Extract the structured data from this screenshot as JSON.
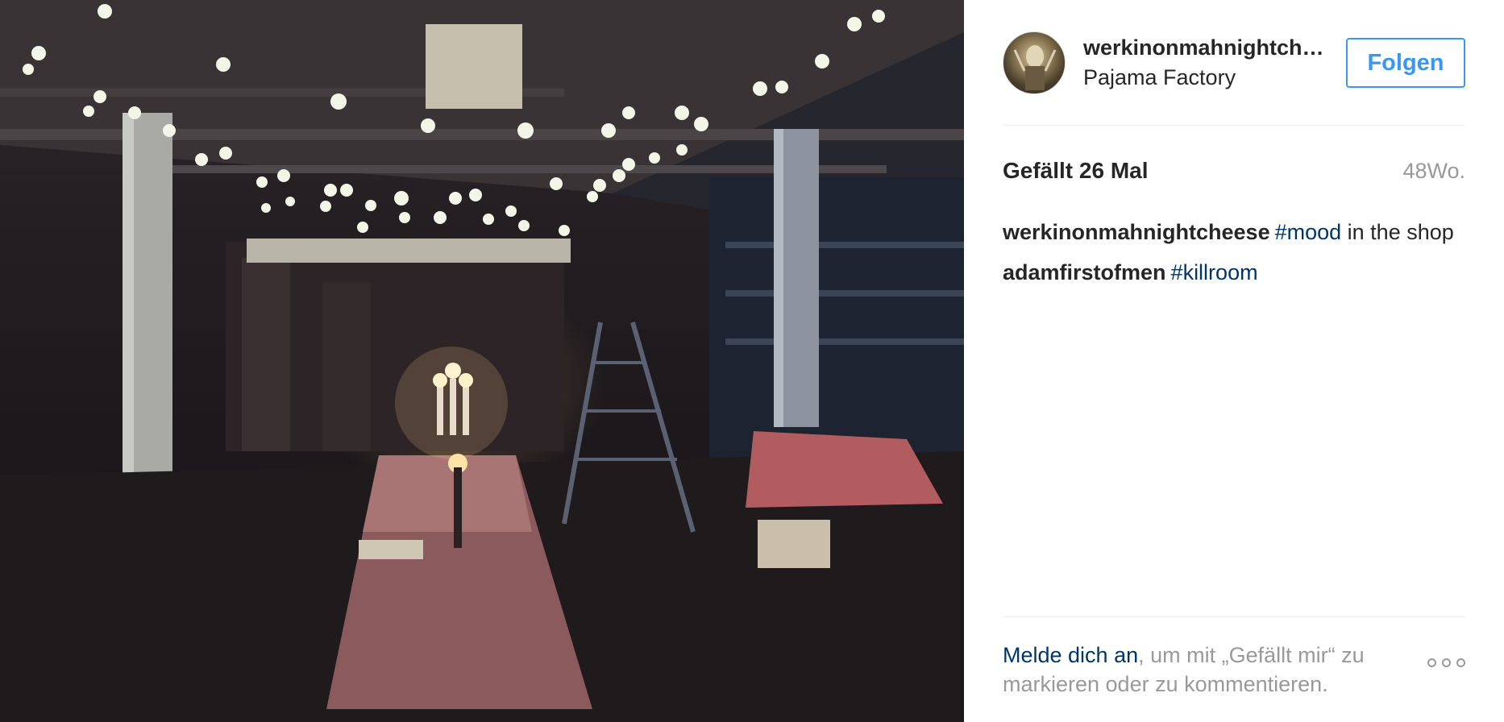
{
  "post": {
    "username": "werkinonmahnightcheese",
    "location": "Pajama Factory",
    "follow_label": "Folgen",
    "likes": "Gefällt 26 Mal",
    "age": "48Wo.",
    "comments": [
      {
        "author": "werkinonmahnightcheese",
        "hashtag": "#mood",
        "text": " in the shop"
      },
      {
        "author": "adamfirstofmen",
        "hashtag": "#killroom",
        "text": ""
      }
    ],
    "login_link": "Melde dich an",
    "login_text": ", um mit „Gefällt mir“ zu markieren oder zu kommentieren.",
    "more_icon": "ellipsis-icon"
  }
}
